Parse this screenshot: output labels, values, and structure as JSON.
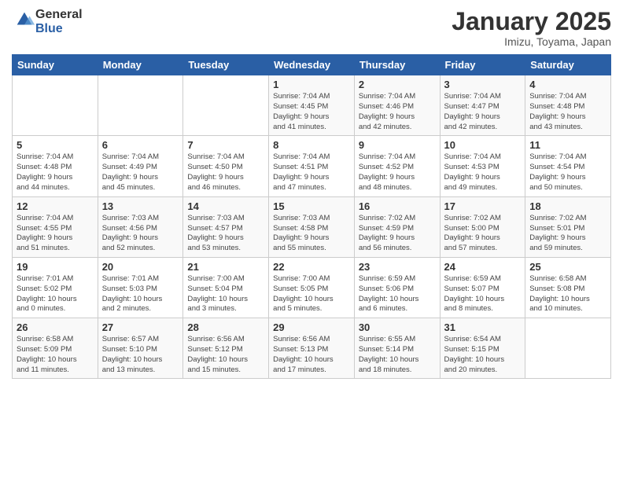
{
  "header": {
    "logo_general": "General",
    "logo_blue": "Blue",
    "month_title": "January 2025",
    "location": "Imizu, Toyama, Japan"
  },
  "weekdays": [
    "Sunday",
    "Monday",
    "Tuesday",
    "Wednesday",
    "Thursday",
    "Friday",
    "Saturday"
  ],
  "weeks": [
    [
      {
        "day": "",
        "info": ""
      },
      {
        "day": "",
        "info": ""
      },
      {
        "day": "",
        "info": ""
      },
      {
        "day": "1",
        "info": "Sunrise: 7:04 AM\nSunset: 4:45 PM\nDaylight: 9 hours\nand 41 minutes."
      },
      {
        "day": "2",
        "info": "Sunrise: 7:04 AM\nSunset: 4:46 PM\nDaylight: 9 hours\nand 42 minutes."
      },
      {
        "day": "3",
        "info": "Sunrise: 7:04 AM\nSunset: 4:47 PM\nDaylight: 9 hours\nand 42 minutes."
      },
      {
        "day": "4",
        "info": "Sunrise: 7:04 AM\nSunset: 4:48 PM\nDaylight: 9 hours\nand 43 minutes."
      }
    ],
    [
      {
        "day": "5",
        "info": "Sunrise: 7:04 AM\nSunset: 4:48 PM\nDaylight: 9 hours\nand 44 minutes."
      },
      {
        "day": "6",
        "info": "Sunrise: 7:04 AM\nSunset: 4:49 PM\nDaylight: 9 hours\nand 45 minutes."
      },
      {
        "day": "7",
        "info": "Sunrise: 7:04 AM\nSunset: 4:50 PM\nDaylight: 9 hours\nand 46 minutes."
      },
      {
        "day": "8",
        "info": "Sunrise: 7:04 AM\nSunset: 4:51 PM\nDaylight: 9 hours\nand 47 minutes."
      },
      {
        "day": "9",
        "info": "Sunrise: 7:04 AM\nSunset: 4:52 PM\nDaylight: 9 hours\nand 48 minutes."
      },
      {
        "day": "10",
        "info": "Sunrise: 7:04 AM\nSunset: 4:53 PM\nDaylight: 9 hours\nand 49 minutes."
      },
      {
        "day": "11",
        "info": "Sunrise: 7:04 AM\nSunset: 4:54 PM\nDaylight: 9 hours\nand 50 minutes."
      }
    ],
    [
      {
        "day": "12",
        "info": "Sunrise: 7:04 AM\nSunset: 4:55 PM\nDaylight: 9 hours\nand 51 minutes."
      },
      {
        "day": "13",
        "info": "Sunrise: 7:03 AM\nSunset: 4:56 PM\nDaylight: 9 hours\nand 52 minutes."
      },
      {
        "day": "14",
        "info": "Sunrise: 7:03 AM\nSunset: 4:57 PM\nDaylight: 9 hours\nand 53 minutes."
      },
      {
        "day": "15",
        "info": "Sunrise: 7:03 AM\nSunset: 4:58 PM\nDaylight: 9 hours\nand 55 minutes."
      },
      {
        "day": "16",
        "info": "Sunrise: 7:02 AM\nSunset: 4:59 PM\nDaylight: 9 hours\nand 56 minutes."
      },
      {
        "day": "17",
        "info": "Sunrise: 7:02 AM\nSunset: 5:00 PM\nDaylight: 9 hours\nand 57 minutes."
      },
      {
        "day": "18",
        "info": "Sunrise: 7:02 AM\nSunset: 5:01 PM\nDaylight: 9 hours\nand 59 minutes."
      }
    ],
    [
      {
        "day": "19",
        "info": "Sunrise: 7:01 AM\nSunset: 5:02 PM\nDaylight: 10 hours\nand 0 minutes."
      },
      {
        "day": "20",
        "info": "Sunrise: 7:01 AM\nSunset: 5:03 PM\nDaylight: 10 hours\nand 2 minutes."
      },
      {
        "day": "21",
        "info": "Sunrise: 7:00 AM\nSunset: 5:04 PM\nDaylight: 10 hours\nand 3 minutes."
      },
      {
        "day": "22",
        "info": "Sunrise: 7:00 AM\nSunset: 5:05 PM\nDaylight: 10 hours\nand 5 minutes."
      },
      {
        "day": "23",
        "info": "Sunrise: 6:59 AM\nSunset: 5:06 PM\nDaylight: 10 hours\nand 6 minutes."
      },
      {
        "day": "24",
        "info": "Sunrise: 6:59 AM\nSunset: 5:07 PM\nDaylight: 10 hours\nand 8 minutes."
      },
      {
        "day": "25",
        "info": "Sunrise: 6:58 AM\nSunset: 5:08 PM\nDaylight: 10 hours\nand 10 minutes."
      }
    ],
    [
      {
        "day": "26",
        "info": "Sunrise: 6:58 AM\nSunset: 5:09 PM\nDaylight: 10 hours\nand 11 minutes."
      },
      {
        "day": "27",
        "info": "Sunrise: 6:57 AM\nSunset: 5:10 PM\nDaylight: 10 hours\nand 13 minutes."
      },
      {
        "day": "28",
        "info": "Sunrise: 6:56 AM\nSunset: 5:12 PM\nDaylight: 10 hours\nand 15 minutes."
      },
      {
        "day": "29",
        "info": "Sunrise: 6:56 AM\nSunset: 5:13 PM\nDaylight: 10 hours\nand 17 minutes."
      },
      {
        "day": "30",
        "info": "Sunrise: 6:55 AM\nSunset: 5:14 PM\nDaylight: 10 hours\nand 18 minutes."
      },
      {
        "day": "31",
        "info": "Sunrise: 6:54 AM\nSunset: 5:15 PM\nDaylight: 10 hours\nand 20 minutes."
      },
      {
        "day": "",
        "info": ""
      }
    ]
  ]
}
